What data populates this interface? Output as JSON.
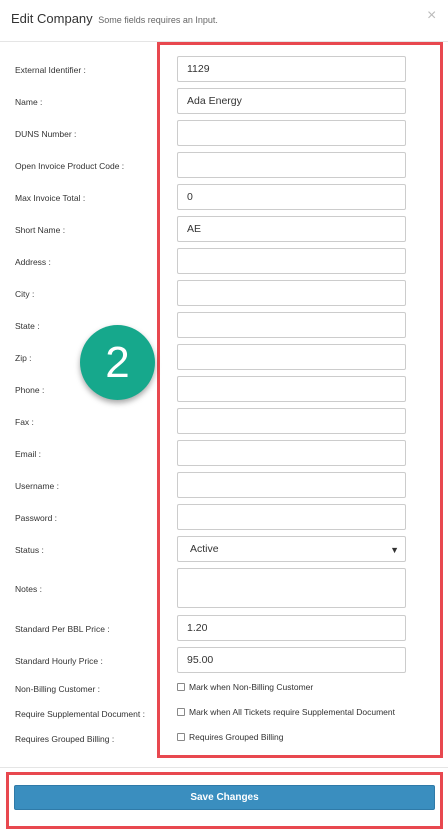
{
  "header": {
    "title": "Edit Company",
    "subtitle": "Some fields requires an Input.",
    "close_glyph": "×"
  },
  "fields": {
    "external_identifier": {
      "label": "External Identifier :",
      "value": "1129"
    },
    "name": {
      "label": "Name :",
      "value": "Ada Energy"
    },
    "duns_number": {
      "label": "DUNS Number :",
      "value": ""
    },
    "open_invoice_product_code": {
      "label": "Open Invoice Product Code :",
      "value": ""
    },
    "max_invoice_total": {
      "label": "Max Invoice Total :",
      "value": "0"
    },
    "short_name": {
      "label": "Short Name :",
      "value": "AE"
    },
    "address": {
      "label": "Address :",
      "value": ""
    },
    "city": {
      "label": "City :",
      "value": ""
    },
    "state": {
      "label": "State :",
      "value": ""
    },
    "zip": {
      "label": "Zip :",
      "value": ""
    },
    "phone": {
      "label": "Phone :",
      "value": ""
    },
    "fax": {
      "label": "Fax :",
      "value": ""
    },
    "email": {
      "label": "Email :",
      "value": ""
    },
    "username": {
      "label": "Username :",
      "value": ""
    },
    "password": {
      "label": "Password :",
      "value": ""
    },
    "status": {
      "label": "Status :",
      "value": "Active",
      "caret": "▼"
    },
    "notes": {
      "label": "Notes :",
      "value": ""
    },
    "standard_per_bbl_price": {
      "label": "Standard Per BBL Price :",
      "value": "1.20"
    },
    "standard_hourly_price": {
      "label": "Standard Hourly Price :",
      "value": "95.00"
    },
    "non_billing_customer": {
      "label": "Non-Billing Customer :",
      "checkbox_label": "Mark when Non-Billing Customer",
      "checked": false
    },
    "require_supplemental_document": {
      "label": "Require Supplemental Document :",
      "checkbox_label": "Mark when All Tickets require Supplemental Document",
      "checked": false
    },
    "requires_grouped_billing": {
      "label": "Requires Grouped Billing :",
      "checkbox_label": "Requires Grouped Billing",
      "checked": false
    }
  },
  "footer": {
    "save_label": "Save Changes"
  },
  "annotation": {
    "step_number": "2",
    "badge_color": "#16a88c",
    "highlight_color": "#e8484f"
  },
  "colors": {
    "button_primary": "#3a8ebf"
  }
}
